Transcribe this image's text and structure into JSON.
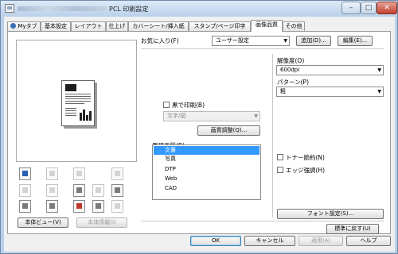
{
  "window": {
    "title": "PCL 印刷設定",
    "controls": {
      "minimize": "–",
      "maximize": "□",
      "close": "✕"
    }
  },
  "tabs": [
    {
      "label": "Myタブ"
    },
    {
      "label": "基本設定"
    },
    {
      "label": "レイアウト"
    },
    {
      "label": "仕上げ"
    },
    {
      "label": "カバーシート/挿入紙"
    },
    {
      "label": "スタンプ/ページ印字"
    },
    {
      "label": "画像品質"
    },
    {
      "label": "その他"
    }
  ],
  "preview_buttons": {
    "printer_view": "本体ビュー(V)",
    "printer_info": "本体情報(I)"
  },
  "favorites": {
    "label": "お気に入り(F)",
    "value": "ユーザー設定",
    "add_button": "追加(D)...",
    "edit_button": "編集(E)..."
  },
  "resolution": {
    "label": "解像度(O)",
    "value": "600dpi"
  },
  "pattern": {
    "label": "パターン(P)",
    "value": "粗"
  },
  "grayscale": {
    "label": "黒で印刷(B)",
    "checked": false,
    "mode_value": "文字/図",
    "adjust_button": "画質調整(Q)..."
  },
  "original_quality": {
    "label": "原稿画質(R)",
    "items": [
      "文書",
      "写真",
      "DTP",
      "Web",
      "CAD"
    ],
    "selected": "文書"
  },
  "toner_save": {
    "label": "トナー節約(N)",
    "checked": false
  },
  "edge_enhance": {
    "label": "エッジ強調(H)",
    "checked": false
  },
  "font_settings_button": "フォント設定(S)...",
  "restore_defaults_button": "標準に戻す(U)",
  "footer": {
    "ok": "OK",
    "cancel": "キャンセル",
    "apply": "適用(A)",
    "help": "ヘルプ"
  },
  "colors": {
    "title_bar": "#b9d1ea",
    "selection": "#3399ff",
    "close_button": "#c2412f"
  }
}
